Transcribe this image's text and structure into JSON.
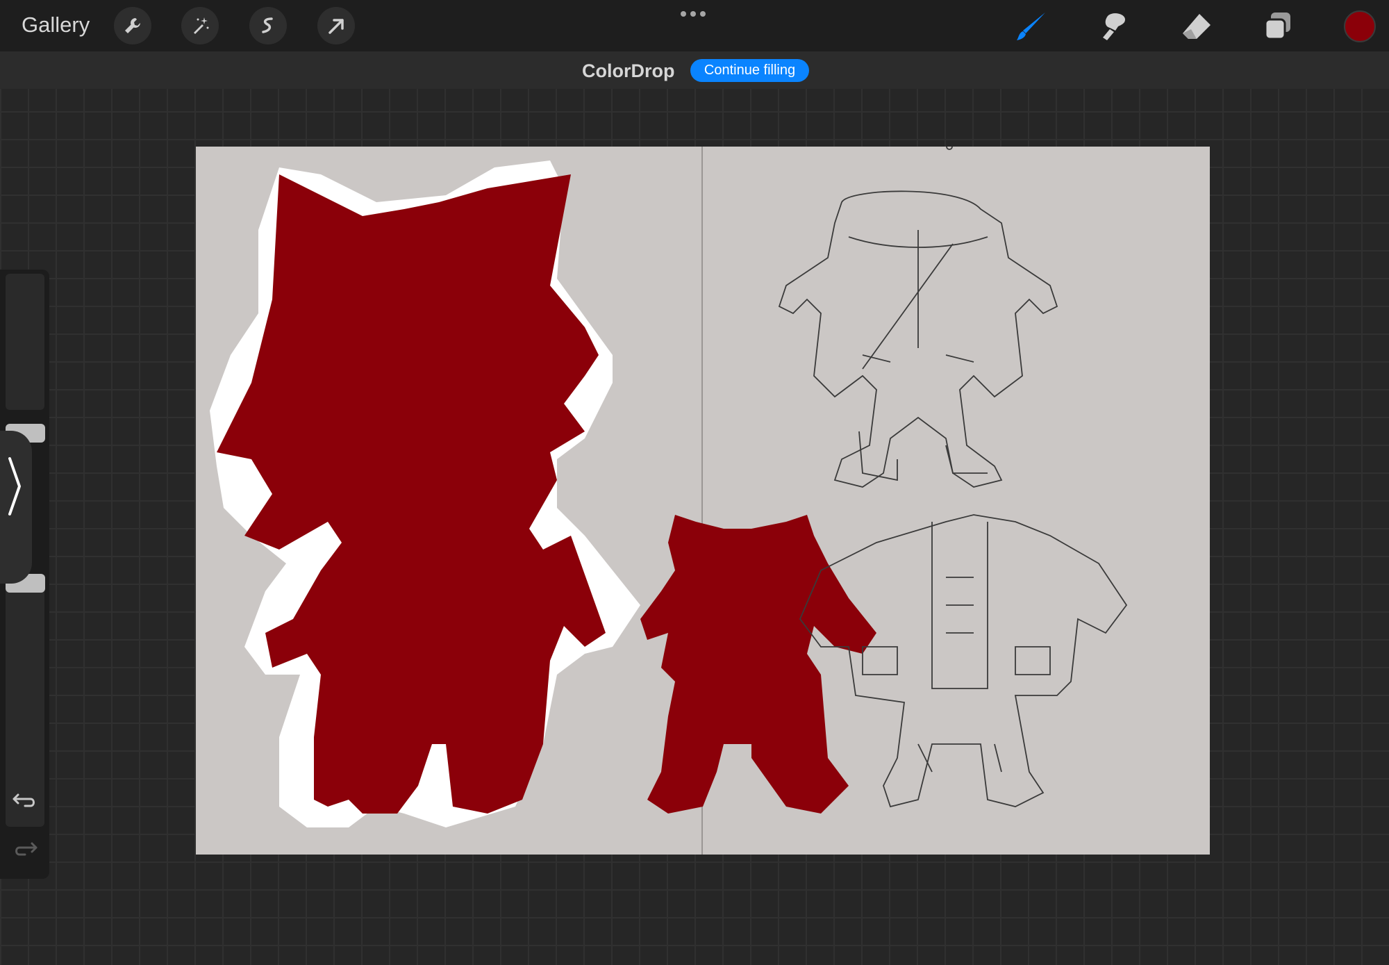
{
  "topbar": {
    "gallery_label": "Gallery",
    "tools": [
      "wrench-icon",
      "magic-wand-icon",
      "selection-icon",
      "transform-arrow-icon"
    ],
    "right_tools": [
      "brush-icon",
      "smudge-icon",
      "eraser-icon",
      "layers-icon"
    ],
    "active_tool": "brush-icon",
    "accent_color": "#0a84ff",
    "current_color": "#8b0009"
  },
  "mode_bar": {
    "title": "ColorDrop",
    "button_label": "Continue filling"
  },
  "canvas": {
    "background_color": "#cbc7c5",
    "fill_color": "#8b0009"
  },
  "sidebar": {
    "icons": [
      "undo-icon",
      "redo-icon"
    ]
  }
}
